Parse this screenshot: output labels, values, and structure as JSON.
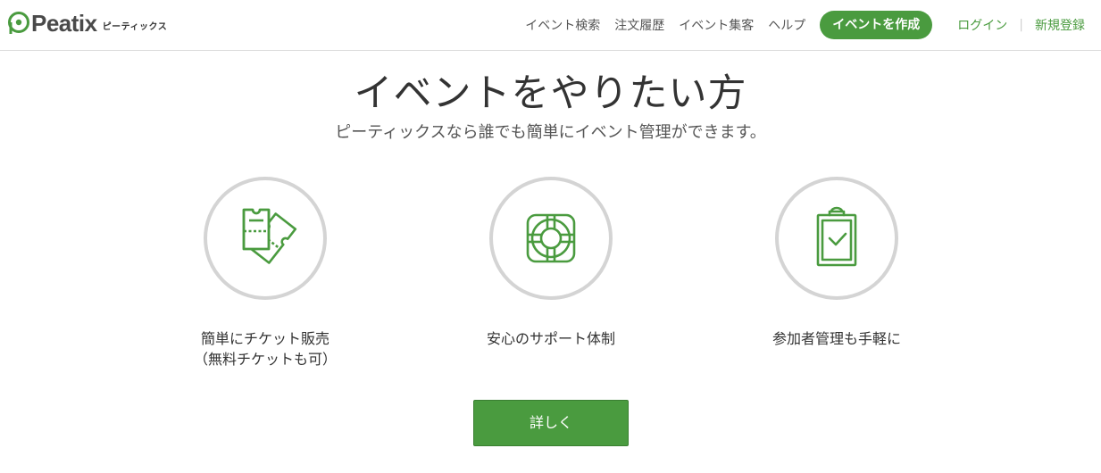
{
  "header": {
    "logo_text": "Peatix",
    "logo_subtitle": "ピーティックス",
    "nav": [
      {
        "label": "イベント検索"
      },
      {
        "label": "注文履歴"
      },
      {
        "label": "イベント集客"
      },
      {
        "label": "ヘルプ"
      }
    ],
    "create_button": "イベントを作成",
    "login": "ログイン",
    "separator": "|",
    "signup": "新規登録"
  },
  "main": {
    "title": "イベントをやりたい方",
    "subtitle": "ピーティックスなら誰でも簡単にイベント管理ができます。",
    "features": [
      {
        "icon": "ticket-icon",
        "line1": "簡単にチケット販売",
        "line2": "（無料チケットも可）"
      },
      {
        "icon": "lifebuoy-icon",
        "line1": "安心のサポート体制",
        "line2": ""
      },
      {
        "icon": "clipboard-check-icon",
        "line1": "参加者管理も手軽に",
        "line2": ""
      }
    ],
    "more_button": "詳しく"
  },
  "colors": {
    "brand_green": "#4a9b3f",
    "circle_border": "#d4d4d4",
    "text_dark": "#333333",
    "text_muted": "#555555"
  }
}
